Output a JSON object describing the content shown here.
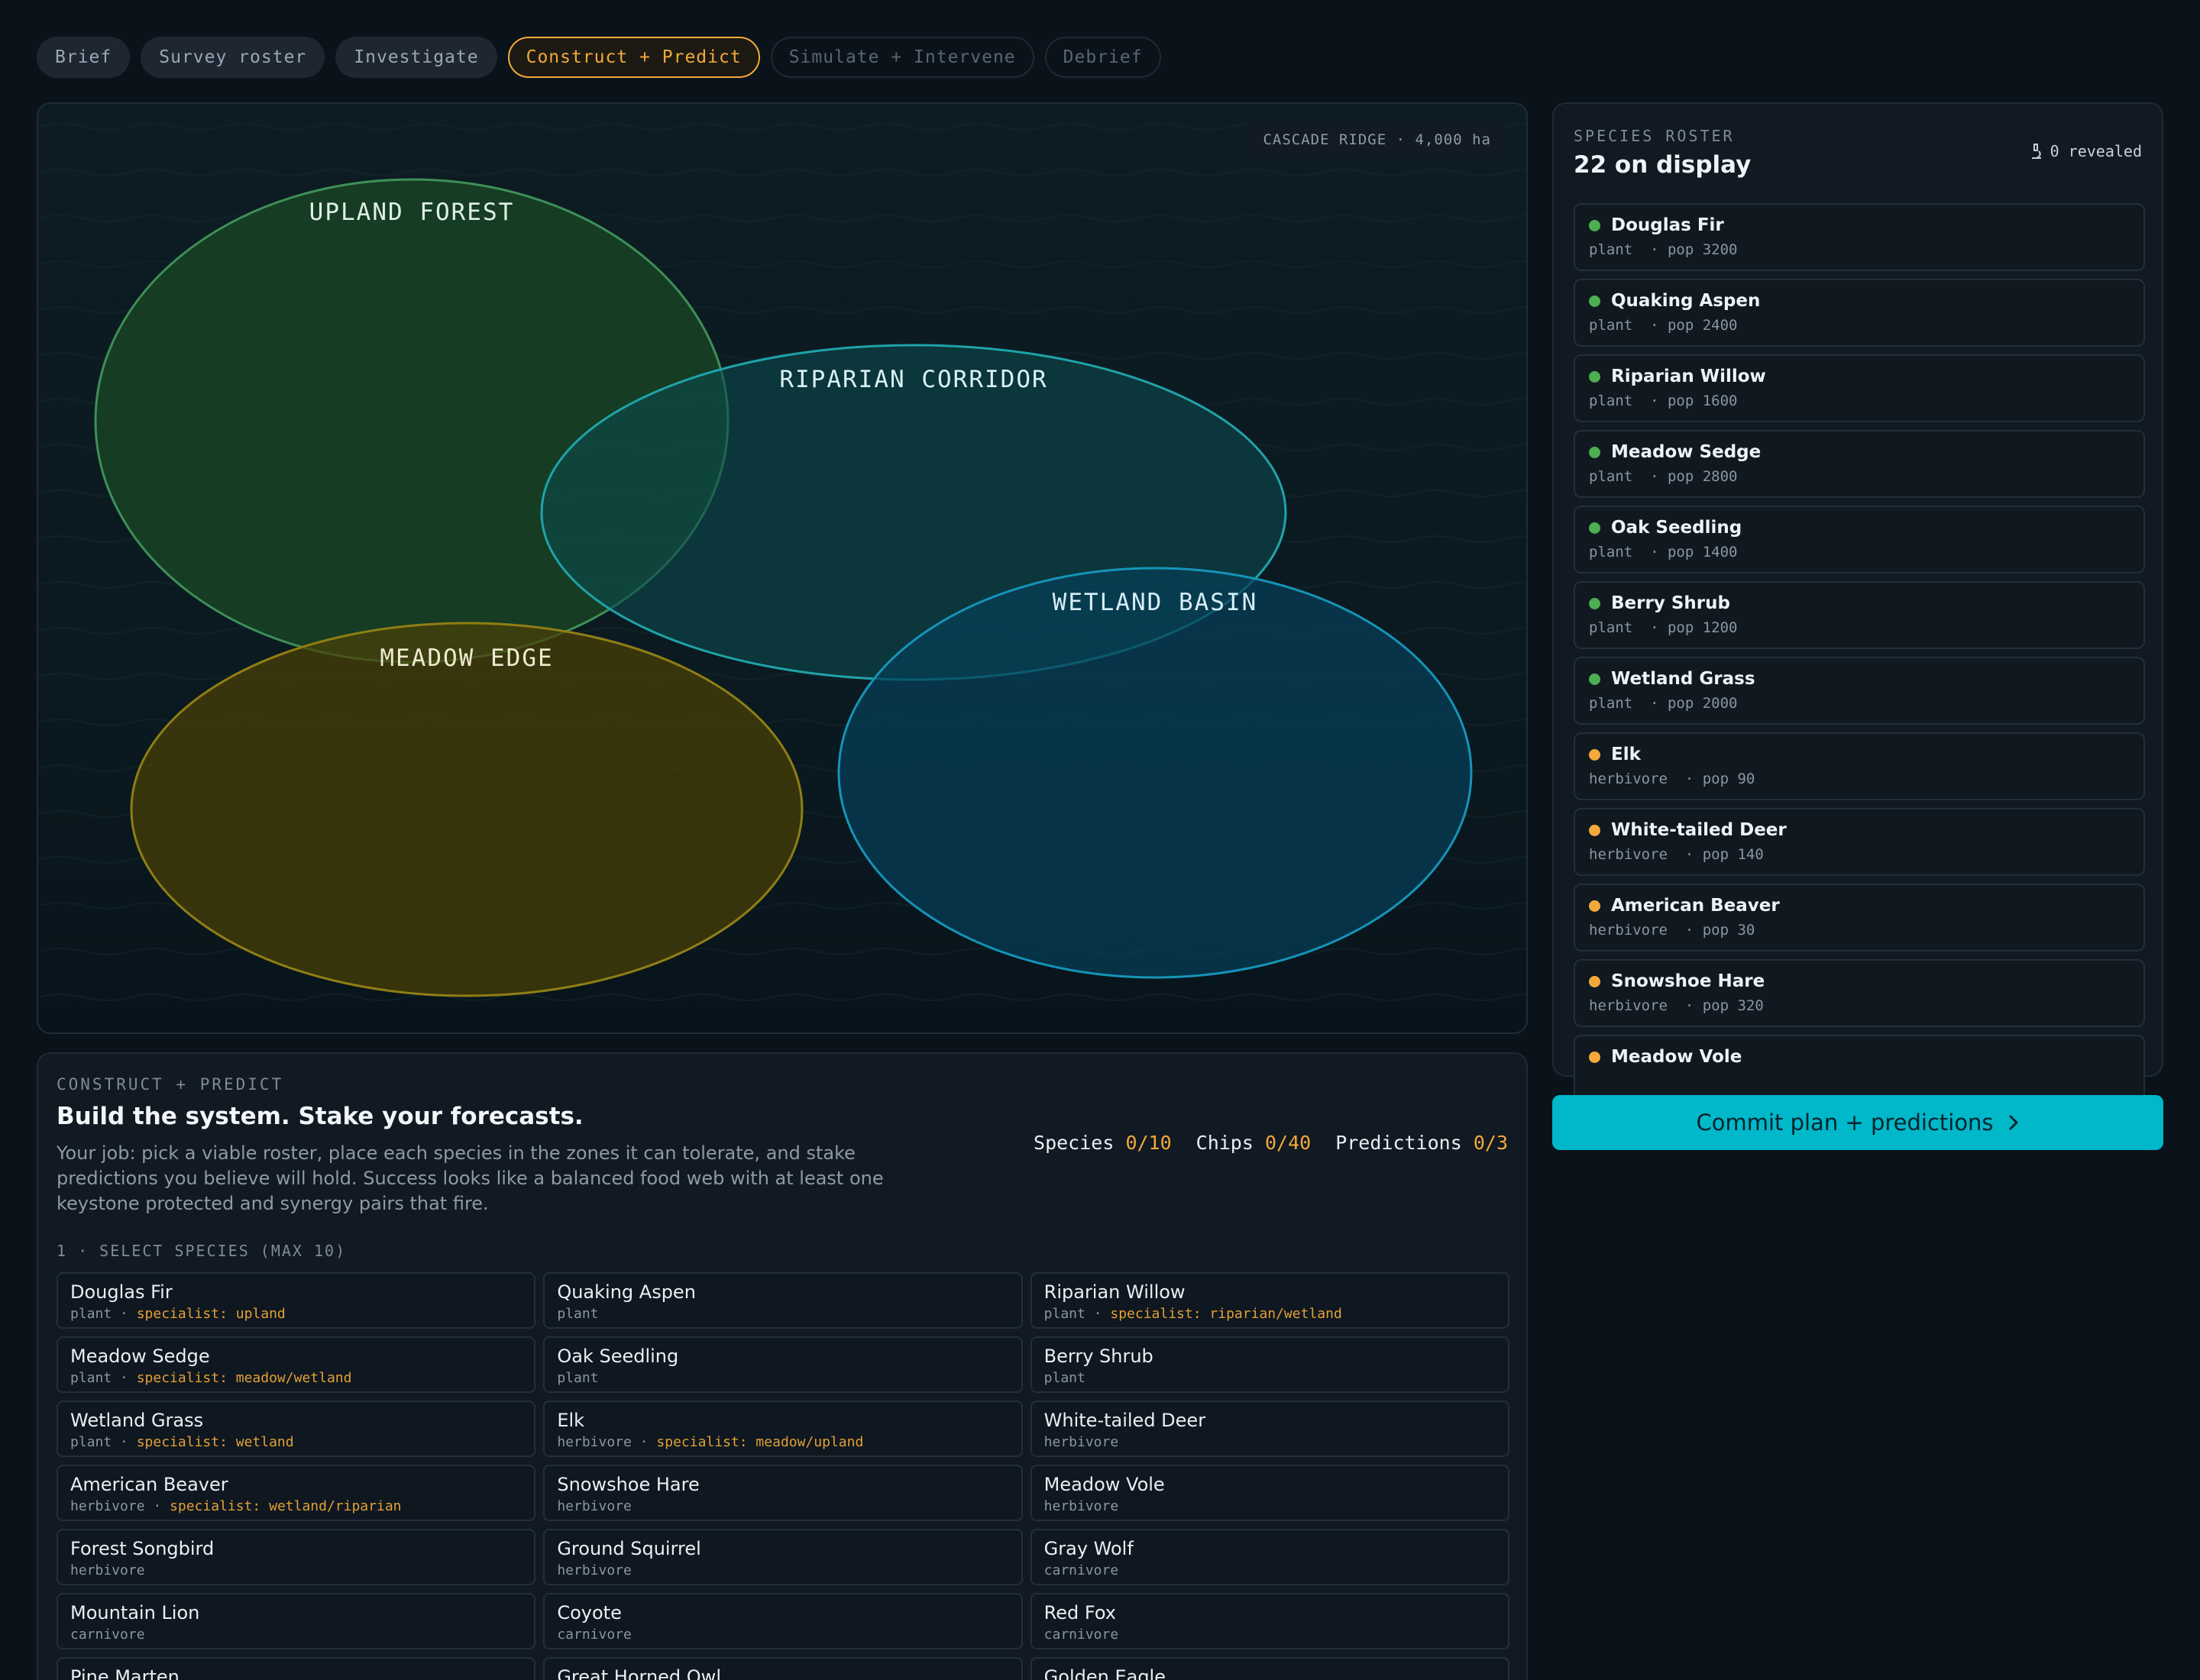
{
  "tabs": [
    {
      "label": "Brief",
      "state": "done"
    },
    {
      "label": "Survey roster",
      "state": "done"
    },
    {
      "label": "Investigate",
      "state": "done"
    },
    {
      "label": "Construct + Predict",
      "state": "active"
    },
    {
      "label": "Simulate + Intervene",
      "state": "future"
    },
    {
      "label": "Debrief",
      "state": "future"
    }
  ],
  "map": {
    "site_label": "CASCADE RIDGE · 4,000 ha",
    "zones": {
      "upland": "UPLAND FOREST",
      "riparian": "RIPARIAN CORRIDOR",
      "meadow": "MEADOW EDGE",
      "wetland": "WETLAND BASIN"
    }
  },
  "roster": {
    "eyebrow": "SPECIES ROSTER",
    "title": "22 on display",
    "revealed": "0 revealed",
    "colors": {
      "plant": "#4caf50",
      "herbivore": "#f3a93b"
    },
    "items": [
      {
        "name": "Douglas Fir",
        "meta": "plant  · pop 3200",
        "kind": "plant"
      },
      {
        "name": "Quaking Aspen",
        "meta": "plant  · pop 2400",
        "kind": "plant"
      },
      {
        "name": "Riparian Willow",
        "meta": "plant  · pop 1600",
        "kind": "plant"
      },
      {
        "name": "Meadow Sedge",
        "meta": "plant  · pop 2800",
        "kind": "plant"
      },
      {
        "name": "Oak Seedling",
        "meta": "plant  · pop 1400",
        "kind": "plant"
      },
      {
        "name": "Berry Shrub",
        "meta": "plant  · pop 1200",
        "kind": "plant"
      },
      {
        "name": "Wetland Grass",
        "meta": "plant  · pop 2000",
        "kind": "plant"
      },
      {
        "name": "Elk",
        "meta": "herbivore  · pop 90",
        "kind": "herbivore"
      },
      {
        "name": "White-tailed Deer",
        "meta": "herbivore  · pop 140",
        "kind": "herbivore"
      },
      {
        "name": "American Beaver",
        "meta": "herbivore  · pop 30",
        "kind": "herbivore"
      },
      {
        "name": "Snowshoe Hare",
        "meta": "herbivore  · pop 320",
        "kind": "herbivore"
      },
      {
        "name": "Meadow Vole",
        "meta": "",
        "kind": "herbivore"
      }
    ]
  },
  "commit_label": "Commit plan + predictions",
  "construct": {
    "eyebrow": "CONSTRUCT + PREDICT",
    "title": "Build the system. Stake your forecasts.",
    "description": "Your job: pick a viable roster, place each species in the zones it can tolerate, and stake predictions you believe will hold. Success looks like a balanced food web with at least one keystone protected and synergy pairs that fire.",
    "stats": {
      "species_label": "Species",
      "species_value": "0/10",
      "chips_label": "Chips",
      "chips_value": "0/40",
      "predictions_label": "Predictions",
      "predictions_value": "0/3"
    },
    "step_label": "1 · SELECT SPECIES (MAX 10)",
    "species": [
      {
        "name": "Douglas Fir",
        "kind": "plant",
        "specialist": "specialist: upland"
      },
      {
        "name": "Quaking Aspen",
        "kind": "plant",
        "specialist": ""
      },
      {
        "name": "Riparian Willow",
        "kind": "plant",
        "specialist": "specialist: riparian/wetland"
      },
      {
        "name": "Meadow Sedge",
        "kind": "plant",
        "specialist": "specialist: meadow/wetland"
      },
      {
        "name": "Oak Seedling",
        "kind": "plant",
        "specialist": ""
      },
      {
        "name": "Berry Shrub",
        "kind": "plant",
        "specialist": ""
      },
      {
        "name": "Wetland Grass",
        "kind": "plant",
        "specialist": "specialist: wetland"
      },
      {
        "name": "Elk",
        "kind": "herbivore",
        "specialist": "specialist: meadow/upland"
      },
      {
        "name": "White-tailed Deer",
        "kind": "herbivore",
        "specialist": ""
      },
      {
        "name": "American Beaver",
        "kind": "herbivore",
        "specialist": "specialist: wetland/riparian"
      },
      {
        "name": "Snowshoe Hare",
        "kind": "herbivore",
        "specialist": ""
      },
      {
        "name": "Meadow Vole",
        "kind": "herbivore",
        "specialist": ""
      },
      {
        "name": "Forest Songbird",
        "kind": "herbivore",
        "specialist": ""
      },
      {
        "name": "Ground Squirrel",
        "kind": "herbivore",
        "specialist": ""
      },
      {
        "name": "Gray Wolf",
        "kind": "carnivore",
        "specialist": ""
      },
      {
        "name": "Mountain Lion",
        "kind": "carnivore",
        "specialist": ""
      },
      {
        "name": "Coyote",
        "kind": "carnivore",
        "specialist": ""
      },
      {
        "name": "Red Fox",
        "kind": "carnivore",
        "specialist": ""
      },
      {
        "name": "Pine Marten",
        "kind": "",
        "specialist": ""
      },
      {
        "name": "Great Horned Owl",
        "kind": "",
        "specialist": ""
      },
      {
        "name": "Golden Eagle",
        "kind": "",
        "specialist": ""
      }
    ]
  }
}
